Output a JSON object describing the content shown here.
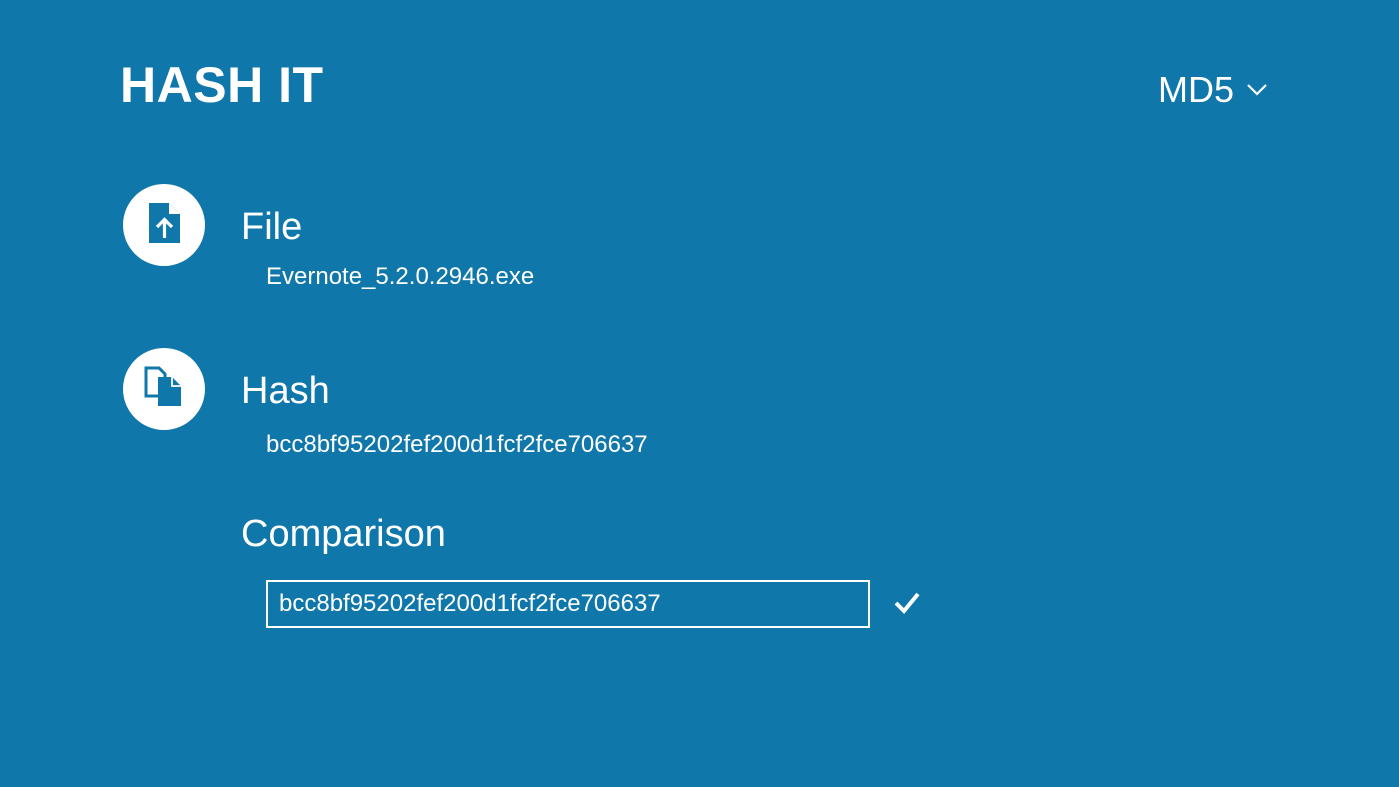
{
  "app": {
    "title": "HASH IT"
  },
  "algorithm": {
    "selected": "MD5",
    "icon": "chevron-down-icon"
  },
  "file": {
    "heading": "File",
    "value": "Evernote_5.2.0.2946.exe",
    "icon": "file-upload-icon"
  },
  "hash": {
    "heading": "Hash",
    "value": "bcc8bf95202fef200d1fcf2fce706637",
    "icon": "copy-icon"
  },
  "comparison": {
    "heading": "Comparison",
    "input_value": "bcc8bf95202fef200d1fcf2fce706637",
    "status_icon": "checkmark-icon"
  },
  "colors": {
    "background": "#1077aa",
    "foreground": "#ffffff"
  }
}
